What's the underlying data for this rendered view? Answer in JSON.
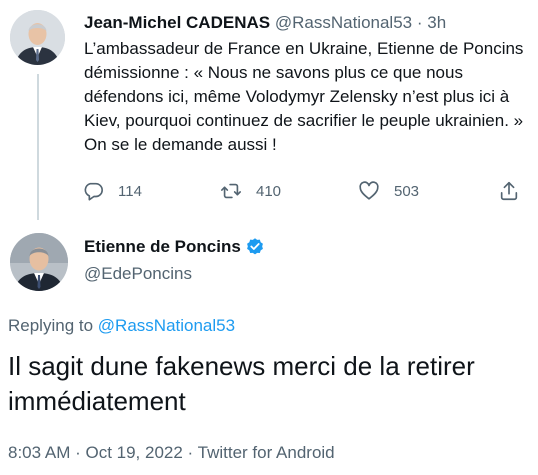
{
  "parent_tweet": {
    "author_name": "Jean-Michel CADENAS",
    "author_handle": "@RassNational53",
    "separator": "·",
    "time_ago": "3h",
    "text": "L’ambassadeur de France en Ukraine, Etienne de Poncins démissionne : « Nous ne savons plus ce que nous défendons ici, même Volodymyr Zelensky n’est plus ici à Kiev, pourquoi continuez de sacrifier le peuple ukrainien. » On se le demande aussi !",
    "actions": {
      "replies": "114",
      "retweets": "410",
      "likes": "503"
    }
  },
  "main_tweet": {
    "author_name": "Etienne de Poncins",
    "author_handle": "@EdePoncins",
    "verified": true,
    "replying_prefix": "Replying to",
    "replying_to": "@RassNational53",
    "text": "Il sagit dune fakenews merci de la retirer immédiatement",
    "meta": "8:03 AM · Oct 19, 2022 · Twitter for Android"
  },
  "icons": [
    "reply-icon",
    "retweet-icon",
    "like-icon",
    "share-icon",
    "verified-badge-icon"
  ],
  "colors": {
    "text_primary": "#0f1419",
    "text_secondary": "#536471",
    "accent": "#1d9bf0",
    "thread_line": "#cfd9de"
  }
}
